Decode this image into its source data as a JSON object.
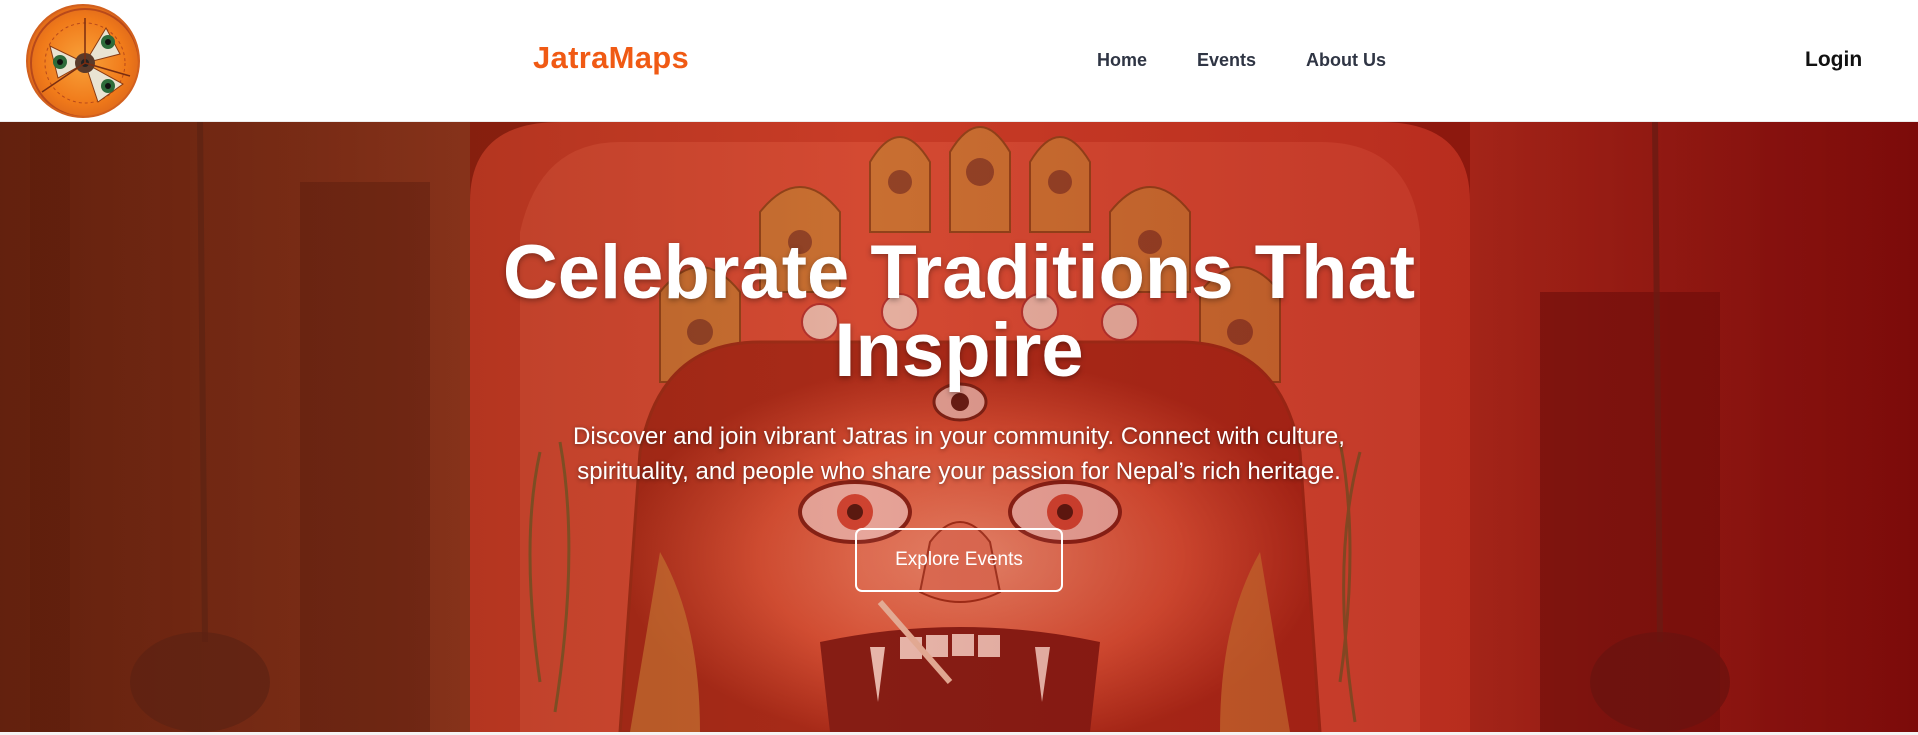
{
  "brand": {
    "name": "JatraMaps",
    "color": "#f05a14"
  },
  "nav": {
    "links": [
      {
        "label": "Home"
      },
      {
        "label": "Events"
      },
      {
        "label": "About Us"
      }
    ],
    "login_label": "Login"
  },
  "logo": {
    "icon": "mask-emblem-icon"
  },
  "hero": {
    "title_lines": [
      "Celebrate Traditions That",
      "Inspire"
    ],
    "subtitle_lines": [
      "Discover and join vibrant Jatras in your community. Connect with culture,",
      "spirituality, and people who share your passion for Nepal’s rich heritage."
    ],
    "cta_label": "Explore Events",
    "background_image": "deity-mask-photo",
    "overlay_color": "#c83220"
  }
}
